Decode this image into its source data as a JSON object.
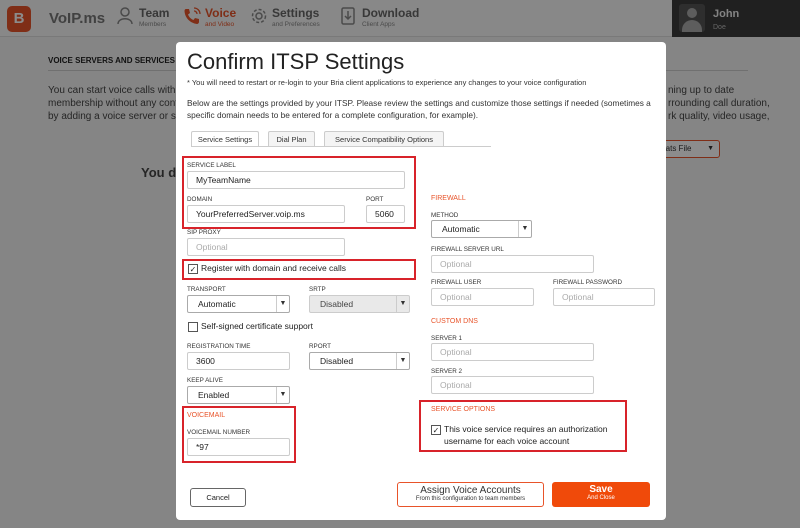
{
  "app": {
    "brand": "VoIP.ms",
    "logo_letter": "B"
  },
  "nav": [
    {
      "title": "Team",
      "sub": "Members",
      "icon": "person-icon"
    },
    {
      "title": "Voice",
      "sub": "and Video",
      "icon": "phone-icon",
      "active": true
    },
    {
      "title": "Settings",
      "sub": "and Preferences",
      "icon": "gear-icon"
    },
    {
      "title": "Download",
      "sub": "Client Apps",
      "icon": "download-icon"
    }
  ],
  "user": {
    "name": "John",
    "sub": "Doe"
  },
  "background": {
    "section": "VOICE SERVERS AND SERVICES",
    "line1": "You can start voice calls with",
    "line2": "membership without any cont",
    "line3": "by adding a voice server or se",
    "right1": "ning up to date",
    "right2": "rrounding call duration,",
    "right3": "rk quality, video usage,",
    "big": "You do",
    "format_label": "rats File"
  },
  "modal": {
    "title": "Confirm ITSP Settings",
    "note": "* You will need to restart or re-login to your Bria client applications to experience any changes to your voice configuration",
    "desc": "Below are the settings provided by your ITSP. Please review the settings and customize those settings if needed (sometimes a specific domain needs to be entered for a complete configuration, for example).",
    "tabs": [
      "Service Settings",
      "Dial Plan",
      "Service Compatibility Options"
    ],
    "service_label": {
      "label": "SERVICE LABEL",
      "value": "MyTeamName"
    },
    "domain": {
      "label": "DOMAIN",
      "value": "YourPreferredServer.voip.ms"
    },
    "port": {
      "label": "PORT",
      "value": "5060"
    },
    "sip_proxy": {
      "label": "SIP PROXY",
      "placeholder": "Optional"
    },
    "register": {
      "label": "Register with domain and receive calls",
      "checked": true
    },
    "transport": {
      "label": "TRANSPORT",
      "value": "Automatic"
    },
    "srtp": {
      "label": "SRTP",
      "value": "Disabled"
    },
    "self_signed": {
      "label": "Self-signed certificate support",
      "checked": false
    },
    "registration_time": {
      "label": "REGISTRATION TIME",
      "value": "3600"
    },
    "rport": {
      "label": "RPORT",
      "value": "Disabled"
    },
    "keep_alive": {
      "label": "KEEP ALIVE",
      "value": "Enabled"
    },
    "voicemail": {
      "heading": "VOICEMAIL",
      "label": "VOICEMAIL NUMBER",
      "value": "*97"
    },
    "firewall": {
      "heading": "FIREWALL",
      "method_label": "METHOD",
      "method_value": "Automatic",
      "server_url_label": "FIREWALL SERVER URL",
      "server_url_placeholder": "Optional",
      "user_label": "FIREWALL USER",
      "user_placeholder": "Optional",
      "password_label": "FIREWALL PASSWORD",
      "password_placeholder": "Optional"
    },
    "custom_dns": {
      "heading": "CUSTOM DNS",
      "server1_label": "SERVER 1",
      "server1_placeholder": "Optional",
      "server2_label": "SERVER 2",
      "server2_placeholder": "Optional"
    },
    "service_options": {
      "heading": "SERVICE OPTIONS",
      "auth_line1": "This voice service requires an authorization",
      "auth_line2": "username for each voice account",
      "checked": true
    },
    "buttons": {
      "cancel": "Cancel",
      "assign": "Assign Voice Accounts",
      "assign_sub": "From this configuration to team members",
      "save": "Save",
      "save_sub": "And Close"
    }
  },
  "colors": {
    "accent": "#e8542a",
    "highlight": "#d8232a",
    "save": "#f04a0a"
  }
}
